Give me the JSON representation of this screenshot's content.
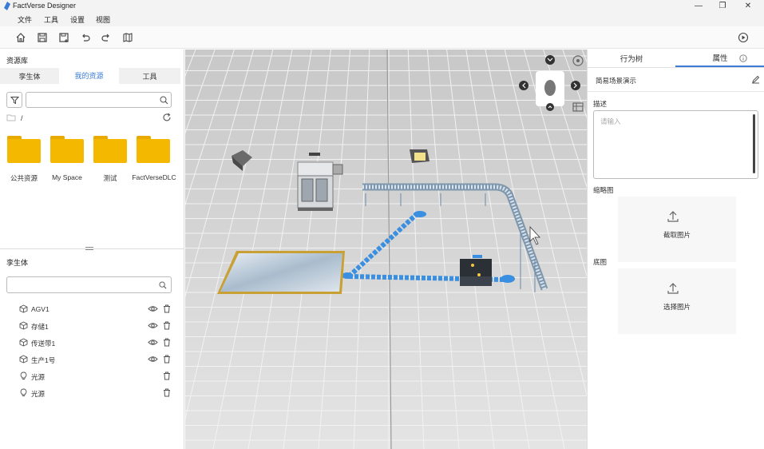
{
  "window": {
    "title": "FactVerse Designer",
    "controls": [
      "—",
      "❐",
      "✕"
    ]
  },
  "menu": [
    "文件",
    "工具",
    "设置",
    "视图"
  ],
  "toolbar": {
    "icons": [
      "home-icon",
      "save-icon",
      "save-as-icon",
      "undo-icon",
      "redo-icon",
      "map-icon",
      "play-icon"
    ]
  },
  "resource_library": {
    "title": "资源库",
    "tabs": [
      "孪生体",
      "我的资源",
      "工具"
    ],
    "active_tab": 1,
    "path": "/",
    "folders": [
      "公共资源",
      "My Space",
      "测试",
      "FactVerseDLC"
    ]
  },
  "twin_outline": {
    "title": "孪生体",
    "items": [
      {
        "label": "AGV1",
        "icon": "cube-icon",
        "visible": true
      },
      {
        "label": "存储1",
        "icon": "cube-icon",
        "visible": true
      },
      {
        "label": "传送带1",
        "icon": "cube-icon",
        "visible": true
      },
      {
        "label": "生产1号",
        "icon": "cube-icon",
        "visible": true
      },
      {
        "label": "光源",
        "icon": "bulb-icon",
        "visible": false
      },
      {
        "label": "光源",
        "icon": "bulb-icon",
        "visible": false
      }
    ]
  },
  "properties": {
    "tabs": [
      "行为树",
      "属性"
    ],
    "active_tab": 1,
    "scene_name": "简易场景演示",
    "description_label": "描述",
    "description_placeholder": "请输入",
    "thumbnail_label": "缩略图",
    "thumbnail_action": "截取图片",
    "base_label": "底图",
    "base_action": "选择图片"
  },
  "colors": {
    "accent": "#3a7bd5",
    "folder": "#f5b800",
    "path": "#3a8fe0"
  }
}
